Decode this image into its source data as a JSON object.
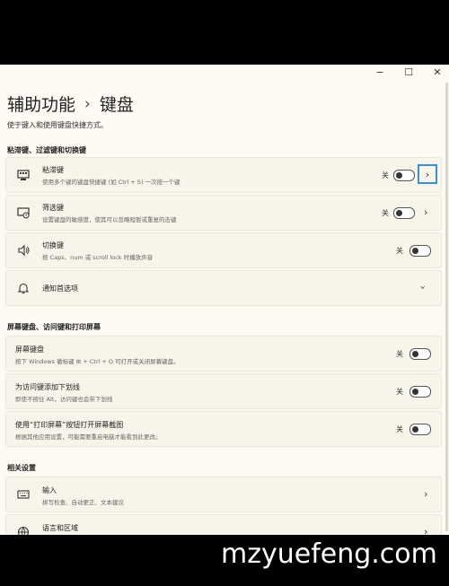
{
  "window": {
    "controls": [
      "−",
      "☐",
      "✕"
    ]
  },
  "breadcrumb": {
    "parent": "辅助功能",
    "separator": "›",
    "current": "键盘"
  },
  "page_description": "使于键入和使用键盘快捷方式。",
  "sections": {
    "sticky": "粘滞键、过滤键和切换键",
    "screen": "屏幕键盘、访问键和打印屏幕",
    "related": "相关设置"
  },
  "items": {
    "sticky_keys": {
      "title": "粘滞键",
      "subtitle": "使用多个键的键盘快捷键 (如 Ctrl + S) 一次按一个键",
      "state": "关",
      "icon": "sticky-keys-icon"
    },
    "filter_keys": {
      "title": "筛选键",
      "subtitle": "设置键盘的敏感度，使其可以忽略短暂或重复的击键",
      "state": "关",
      "icon": "filter-keys-icon"
    },
    "toggle_keys": {
      "title": "切换键",
      "subtitle": "按 Caps、num 或 scroll lock 时播放声音",
      "state": "关",
      "icon": "speaker-icon"
    },
    "notifications": {
      "title": "通知首选项",
      "icon": "bell-icon"
    },
    "screen_keyboard": {
      "title": "屏幕键盘",
      "subtitle": "按下 Windows 徽标键 ⊞ + Ctrl + O 可打开或关闭屏幕键盘。",
      "state": "关"
    },
    "access_keys": {
      "title": "为访问键添加下划线",
      "subtitle": "即使不按住 Alt，访问键也会带下划线",
      "state": "关"
    },
    "print_screen": {
      "title": "使用“打印屏幕”按钮打开屏幕截图",
      "subtitle": "根据其他应用设置，可能需要重启电脑才能看到此更改。",
      "state": "关"
    },
    "input": {
      "title": "输入",
      "subtitle": "拼写检查、自动更正、文本建议",
      "icon": "keyboard-icon"
    },
    "language": {
      "title": "语言和区域",
      "icon": "language-icon"
    }
  },
  "watermark": "mzyuefeng.com"
}
